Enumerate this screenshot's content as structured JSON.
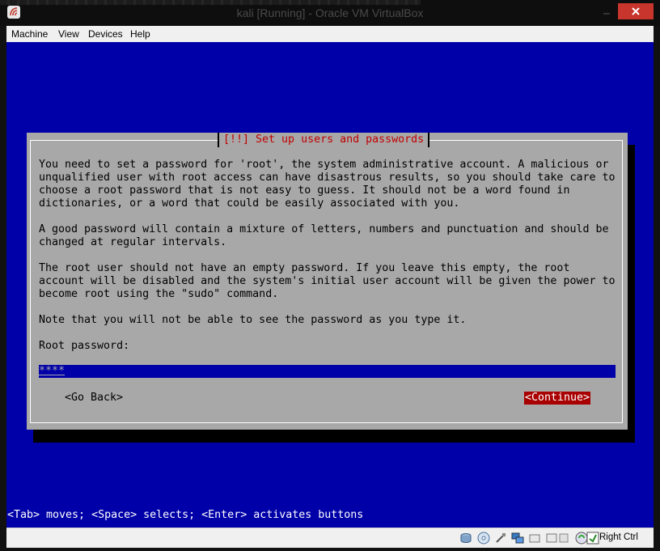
{
  "window": {
    "title": "kali [Running] - Oracle VM VirtualBox",
    "close_color": "#c7352c"
  },
  "menu": {
    "items": [
      "Machine",
      "View",
      "Devices",
      "Help"
    ]
  },
  "installer": {
    "background_color": "#0000a8",
    "dialog_color": "#a8a8a8",
    "title": "[!!] Set up users and passwords",
    "paragraphs": [
      "You need to set a password for 'root', the system administrative account. A malicious or\nunqualified user with root access can have disastrous results, so you should take care to\nchoose a root password that is not easy to guess. It should not be a word found in\ndictionaries, or a word that could be easily associated with you.",
      "A good password will contain a mixture of letters, numbers and punctuation and should be\nchanged at regular intervals.",
      "The root user should not have an empty password. If you leave this empty, the root\naccount will be disabled and the system's initial user account will be given the power to\nbecome root using the \"sudo\" command.",
      "Note that you will not be able to see the password as you type it.",
      "Root password:"
    ],
    "password_value": "****",
    "go_back_label": "<Go Back>",
    "continue_label": "<Continue>",
    "continue_color": "#a80000",
    "help_line": "<Tab> moves; <Space> selects; <Enter> activates buttons"
  },
  "statusbar": {
    "icons": [
      "hard-disk-icon",
      "optical-disk-icon",
      "usb-icon",
      "network-icon",
      "shared-folders-icon",
      "display-icon",
      "video-capture-icon",
      "mouse-integration-icon",
      "host-key-icon"
    ],
    "host_key_label": "Right Ctrl"
  }
}
